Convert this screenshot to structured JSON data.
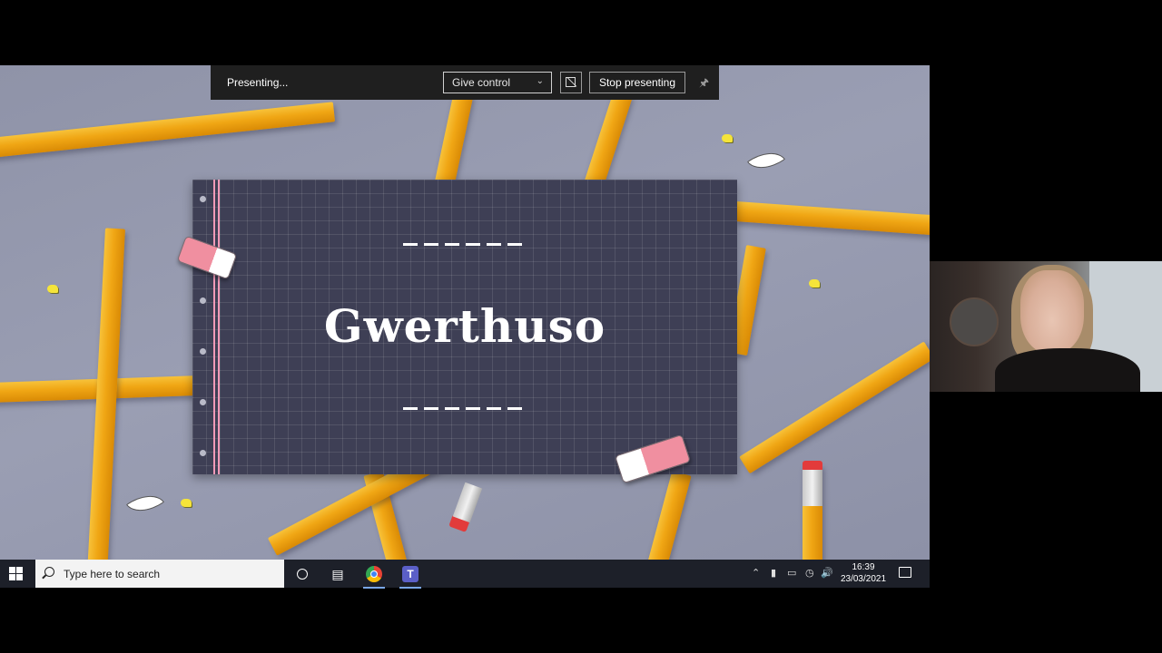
{
  "presenting_bar": {
    "status": "Presenting...",
    "give_control": "Give control",
    "stop": "Stop presenting"
  },
  "slide": {
    "title": "Gwerthuso"
  },
  "taskbar": {
    "search_placeholder": "Type here to search",
    "time": "16:39",
    "date": "23/03/2021"
  },
  "colors": {
    "slide_bg": "#3e3f55",
    "pencil": "#f0a614",
    "taskbar": "#1d2029",
    "present_bar": "#1f1f1f"
  },
  "icons": [
    "windows-start-icon",
    "search-icon",
    "cortana-icon",
    "task-view-icon",
    "chrome-icon",
    "teams-icon",
    "chevron-up-icon",
    "usb-icon",
    "battery-icon",
    "wifi-icon",
    "volume-icon",
    "notification-icon",
    "pin-icon",
    "fullscreen-icon"
  ]
}
